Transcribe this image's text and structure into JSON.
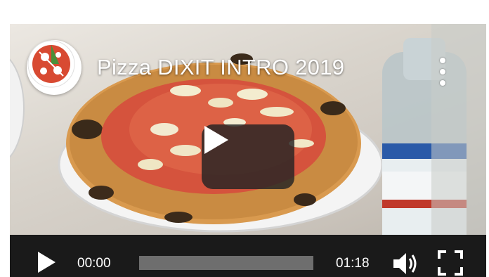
{
  "video": {
    "title": "Pizza DIXIT INTRO 2019",
    "current_time": "00:00",
    "duration": "01:18",
    "progress": 0
  },
  "icons": {
    "logo": "pizza-logo-icon",
    "menu": "kebab-menu-icon",
    "play_overlay": "play-icon",
    "play_control": "play-icon",
    "volume": "volume-icon",
    "fullscreen": "fullscreen-icon"
  },
  "colors": {
    "controls_bg": "#1a1a1a",
    "progress_track": "#6e6e6e",
    "overlay_button": "#232323"
  }
}
